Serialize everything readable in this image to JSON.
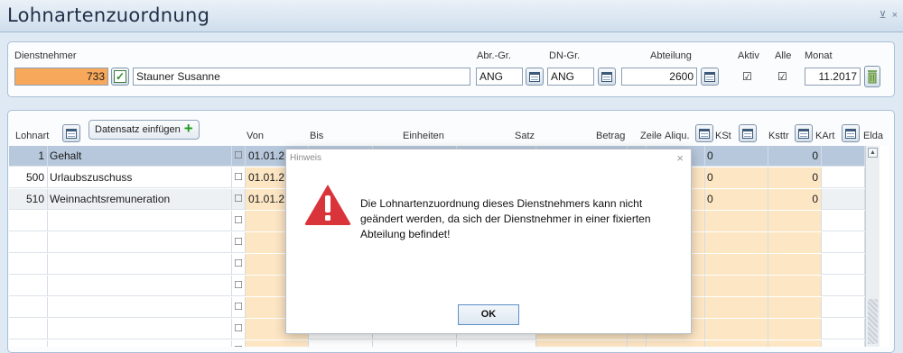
{
  "window": {
    "title": "Lohnartenzuordnung",
    "pin_glyph": "⊻",
    "close_glyph": "×"
  },
  "form": {
    "dienstnehmer_label": "Dienstnehmer",
    "dienstnehmer_nr": "733",
    "dienstnehmer_name": "Stauner Susanne",
    "abr_gr_label": "Abr.-Gr.",
    "abr_gr_value": "ANG",
    "dn_gr_label": "DN-Gr.",
    "dn_gr_value": "ANG",
    "abteilung_label": "Abteilung",
    "abteilung_value": "2600",
    "aktiv_label": "Aktiv",
    "aktiv_checked": "☑",
    "alle_label": "Alle",
    "alle_checked": "☑",
    "monat_label": "Monat",
    "monat_value": "11.2017"
  },
  "grid": {
    "insert_button_label": "Datensatz einfügen",
    "headers": {
      "lohnart": "Lohnart",
      "von": "Von",
      "bis": "Bis",
      "einheiten": "Einheiten",
      "satz": "Satz",
      "betrag": "Betrag",
      "zeile": "Zeile",
      "aliqu": "Aliqu.",
      "kst": "KSt",
      "ksttr": "Ksttr",
      "kart": "KArt",
      "elda": "Elda"
    },
    "rows": [
      {
        "nr": "1",
        "name": "Gehalt",
        "cb": "☐",
        "von": "01.01.2",
        "kst": "0",
        "ksttr": "0",
        "kart": "0"
      },
      {
        "nr": "500",
        "name": "Urlaubszuschuss",
        "cb": "☐",
        "von": "01.01.2",
        "kst": "0",
        "ksttr": "0",
        "kart": "0"
      },
      {
        "nr": "510",
        "name": "Weinnachtsremuneration",
        "cb": "☐",
        "von": "01.01.2",
        "kst": "0",
        "ksttr": "0",
        "kart": "0"
      },
      {
        "nr": "",
        "name": "",
        "cb": "☐",
        "von": "",
        "kst": "",
        "ksttr": "",
        "kart": ""
      },
      {
        "nr": "",
        "name": "",
        "cb": "☐",
        "von": "",
        "kst": "",
        "ksttr": "",
        "kart": ""
      },
      {
        "nr": "",
        "name": "",
        "cb": "☐",
        "von": "",
        "kst": "",
        "ksttr": "",
        "kart": ""
      },
      {
        "nr": "",
        "name": "",
        "cb": "☐",
        "von": "",
        "kst": "",
        "ksttr": "",
        "kart": ""
      },
      {
        "nr": "",
        "name": "",
        "cb": "☐",
        "von": "",
        "kst": "",
        "ksttr": "",
        "kart": ""
      },
      {
        "nr": "",
        "name": "",
        "cb": "☐",
        "von": "",
        "kst": "",
        "ksttr": "",
        "kart": ""
      },
      {
        "nr": "",
        "name": "",
        "cb": "☐",
        "von": "",
        "kst": "",
        "ksttr": "",
        "kart": ""
      }
    ]
  },
  "dialog": {
    "title": "Hinweis",
    "close_glyph": "×",
    "message": "Die Lohnartenzuordnung dieses Dienstnehmers kann nicht geändert werden, da sich der Dienstnehmer in einer fixierten Abteilung befindet!",
    "ok_label": "OK"
  },
  "colors": {
    "accent_orange": "#f7a85a",
    "row_selected": "#b7c8dc",
    "row_highlight": "#eef1f4",
    "warning_red": "#d9343a",
    "cell_peach": "#fde6c4"
  }
}
